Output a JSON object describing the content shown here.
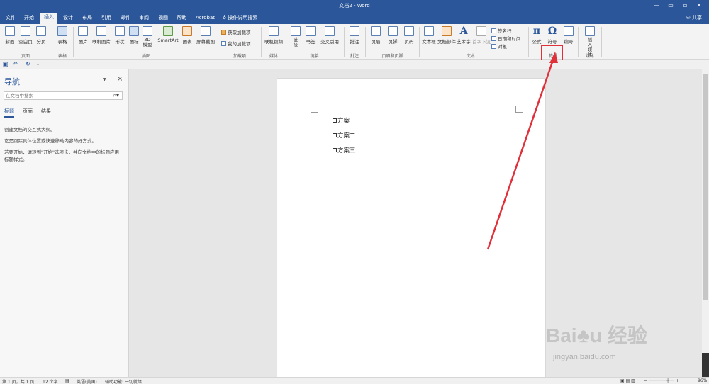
{
  "window": {
    "title": "文档2 - Word",
    "controls": [
      "—",
      "▭",
      "⧉",
      "✕"
    ]
  },
  "tabs": [
    {
      "label": "文件"
    },
    {
      "label": "开始"
    },
    {
      "label": "插入"
    },
    {
      "label": "设计"
    },
    {
      "label": "布局"
    },
    {
      "label": "引用"
    },
    {
      "label": "邮件"
    },
    {
      "label": "审阅"
    },
    {
      "label": "视图"
    },
    {
      "label": "帮助"
    },
    {
      "label": "Acrobat"
    }
  ],
  "tell_me": "操作说明搜索",
  "share": "共享",
  "ribbon": {
    "page": {
      "cover": "封面",
      "blank": "空白页",
      "break": "分页",
      "group": "页面"
    },
    "table": {
      "table": "表格",
      "group": "表格"
    },
    "illustrations": {
      "picture": "图片",
      "online_picture": "联机图片",
      "shapes": "形状",
      "icons": "图标",
      "model3d": "3D模型",
      "smartart": "SmartArt",
      "chart": "图表",
      "screenshot": "屏幕截图",
      "group": "插图"
    },
    "addins": {
      "get": "获取加载项",
      "mine": "我的加载项",
      "group": "加载项"
    },
    "media": {
      "video": "联机视频",
      "group": "媒体"
    },
    "links": {
      "link": "链接",
      "bookmark": "书签",
      "cross_ref": "交叉引用",
      "group": "链接"
    },
    "comments": {
      "comment": "批注",
      "group": "批注"
    },
    "header_footer": {
      "header": "页眉",
      "footer": "页脚",
      "page_number": "页码",
      "group": "页眉和页脚"
    },
    "text": {
      "textbox": "文本框",
      "parts": "文档部件",
      "wordart": "艺术字",
      "dropcap": "首字下沉",
      "signature": "签名行",
      "datetime": "日期和时间",
      "object": "对象",
      "group": "文本"
    },
    "symbols": {
      "equation": "公式",
      "symbol": "符号",
      "number": "编号",
      "group": "符号"
    },
    "embed": {
      "embed_media": "插入媒体",
      "group": "媒体"
    }
  },
  "nav": {
    "title": "导航",
    "search_placeholder": "在文档中搜索",
    "tabs": [
      "标题",
      "页面",
      "结果"
    ],
    "line1": "创建文档的交互式大纲。",
    "line2": "它是跟踪具体位置或快速移动内容的好方式。",
    "line3": "若要开始，请转到\"开始\"选项卡，并向文档中的标题应用标题样式。"
  },
  "document": {
    "paragraphs": [
      "方案一",
      "方案二",
      "方案三"
    ]
  },
  "status": {
    "page": "第 1 页，共 1 页",
    "words": "12 个字",
    "lang": "英语(美国)",
    "accessibility": "辅助功能: 一切就绪",
    "zoom": "96%"
  },
  "watermark": {
    "brand": "Bai",
    "brand2": "经验",
    "url": "jingyan.baidu.com"
  },
  "colors": {
    "accent": "#2b579a",
    "highlight": "#e0303a"
  }
}
